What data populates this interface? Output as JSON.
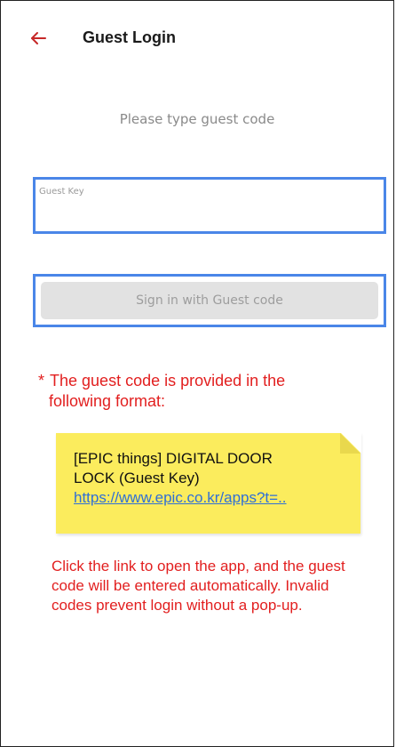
{
  "header": {
    "back_icon": "arrow-left-icon",
    "back_color": "#c62828",
    "title": "Guest Login"
  },
  "main": {
    "subtitle": "Please type guest code",
    "guest_key_field": {
      "label": "Guest Key",
      "value": ""
    },
    "sign_in_button_label": "Sign in with Guest code",
    "highlight_color": "#4a86e8"
  },
  "annotation": {
    "note_star": "*",
    "note_line1": "The guest code is provided in the",
    "note_line2": "following format:",
    "sample_message_line1": "[EPIC things] DIGITAL DOOR",
    "sample_message_line2": "LOCK (Guest Key)",
    "sample_link": "https://www.epic.co.kr/apps?t=..",
    "explanation": "Click the link to open the app, and the guest code will be entered automatically. Invalid codes prevent login without a pop-up.",
    "text_color": "#e21f1f",
    "sticky_color": "#fbec5d"
  }
}
